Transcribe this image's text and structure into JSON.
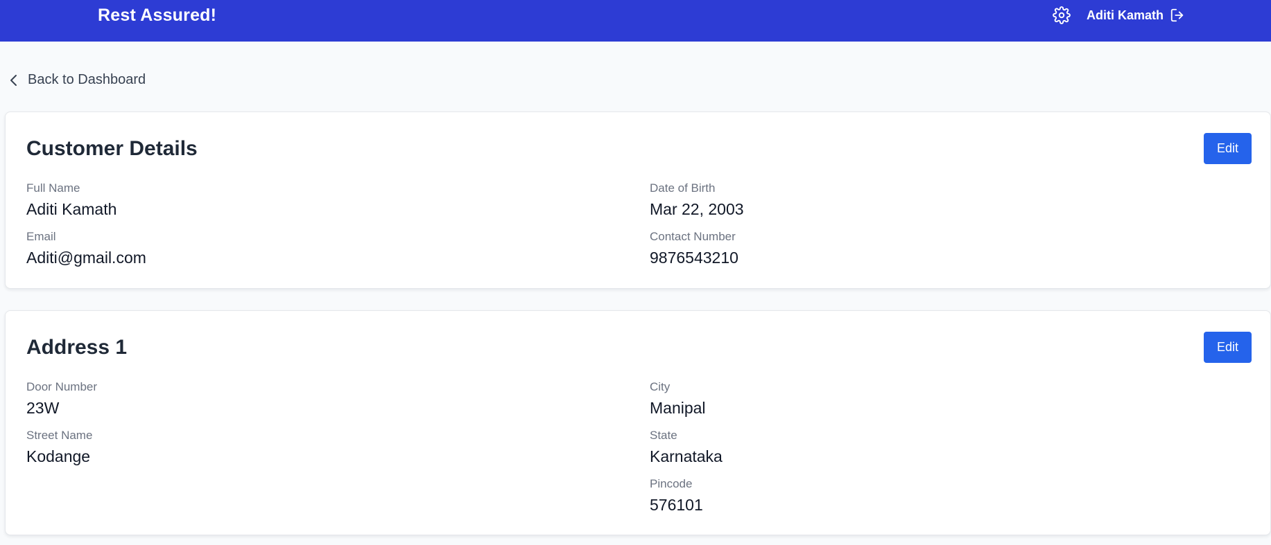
{
  "header": {
    "brand": "Rest Assured!",
    "user_name": "Aditi Kamath",
    "settings_icon": "gear-icon",
    "logout_icon": "logout-icon"
  },
  "navigation": {
    "back_label": "Back to Dashboard",
    "back_icon": "chevron-left-icon"
  },
  "customer": {
    "title": "Customer Details",
    "edit_label": "Edit",
    "full_name_label": "Full Name",
    "full_name": "Aditi Kamath",
    "dob_label": "Date of Birth",
    "dob": "Mar 22, 2003",
    "email_label": "Email",
    "email": "Aditi@gmail.com",
    "contact_label": "Contact Number",
    "contact": "9876543210"
  },
  "address": {
    "title": "Address 1",
    "edit_label": "Edit",
    "door_label": "Door Number",
    "door": "23W",
    "city_label": "City",
    "city": "Manipal",
    "street_label": "Street Name",
    "street": "Kodange",
    "state_label": "State",
    "state": "Karnataka",
    "pincode_label": "Pincode",
    "pincode": "576101"
  },
  "colors": {
    "header": "#2d3cd4",
    "button": "#2563eb",
    "background": "#f8fafc"
  }
}
